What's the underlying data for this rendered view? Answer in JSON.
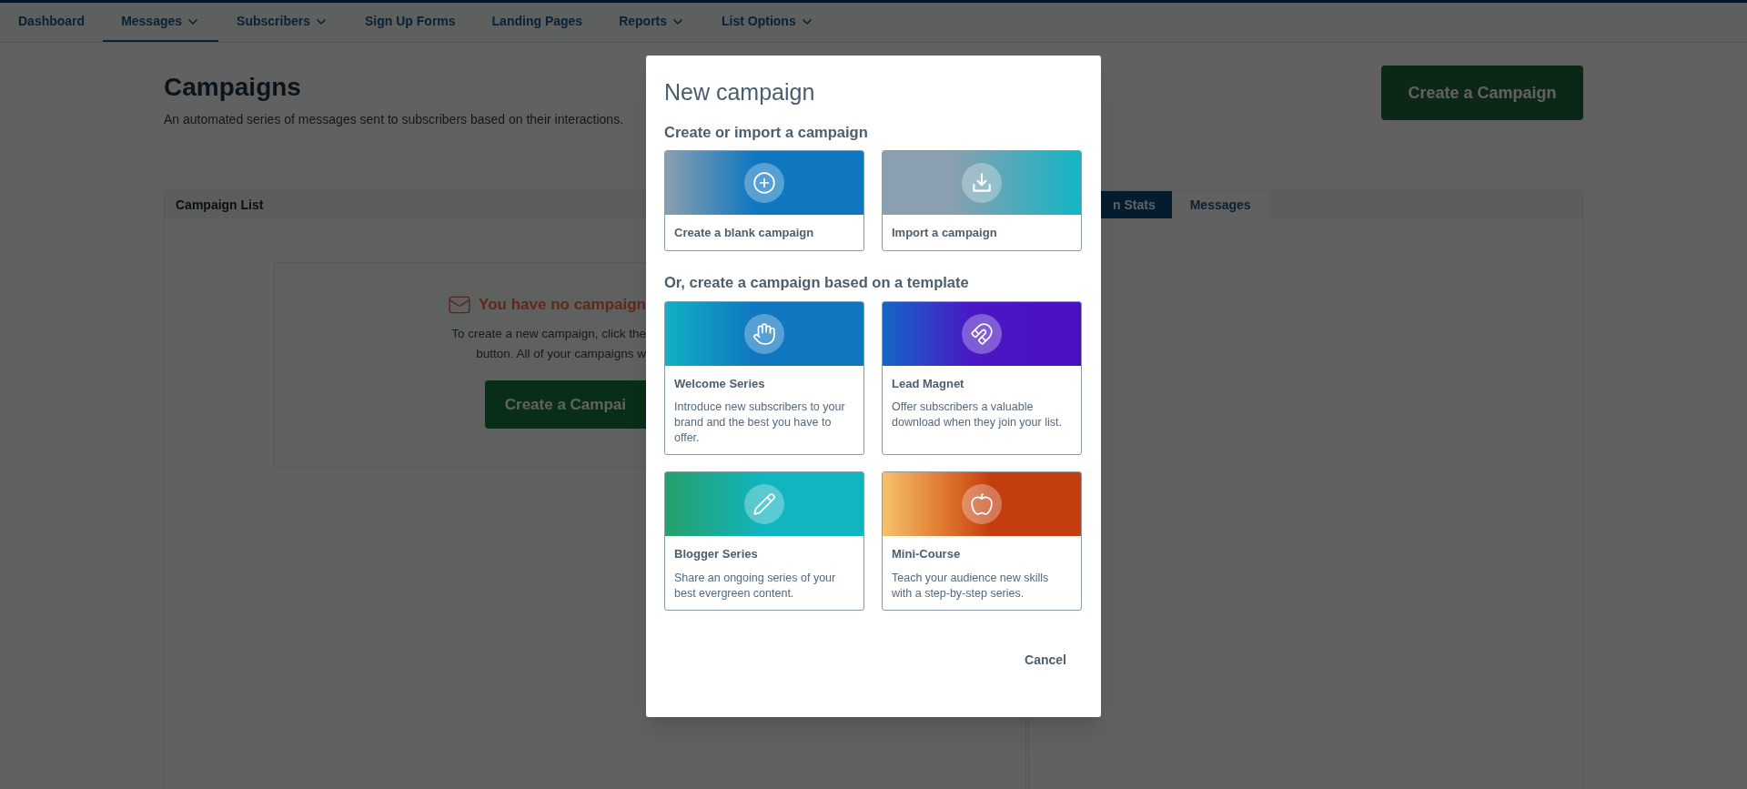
{
  "nav": {
    "items": [
      {
        "label": "Dashboard",
        "selected": false,
        "dropdown": false
      },
      {
        "label": "Messages",
        "selected": true,
        "dropdown": true
      },
      {
        "label": "Subscribers",
        "selected": false,
        "dropdown": true
      },
      {
        "label": "Sign Up Forms",
        "selected": false,
        "dropdown": false
      },
      {
        "label": "Landing Pages",
        "selected": false,
        "dropdown": false
      },
      {
        "label": "Reports",
        "selected": false,
        "dropdown": true
      },
      {
        "label": "List Options",
        "selected": false,
        "dropdown": true
      }
    ]
  },
  "page": {
    "title": "Campaigns",
    "subtitle": "An automated series of messages sent to subscribers based on their interactions.",
    "create_button": "Create a Campaign"
  },
  "campaign_list": {
    "title": "Campaign List",
    "empty_state": {
      "title": "You have no campaign",
      "text_lines": [
        "To create a new campaign, click the",
        "button. All of your campaigns w"
      ],
      "button": "Create a Campai"
    }
  },
  "stats_panel": {
    "tabs": [
      {
        "label": "n Stats",
        "selected": true
      },
      {
        "label": "Messages",
        "selected": false
      }
    ]
  },
  "modal": {
    "title": "New campaign",
    "sections": [
      {
        "heading": "Create or import a campaign",
        "cards": [
          {
            "kind": "blank",
            "title": "Create a blank campaign"
          },
          {
            "kind": "import",
            "title": "Import a campaign"
          }
        ]
      },
      {
        "heading": "Or, create a campaign based on a template",
        "cards": [
          {
            "kind": "welcome",
            "title": "Welcome Series",
            "description": "Introduce new subscribers to your brand and the best you have to offer."
          },
          {
            "kind": "magnet",
            "title": "Lead Magnet",
            "description": "Offer subscribers a valuable download when they join your list."
          },
          {
            "kind": "blogger",
            "title": "Blogger Series",
            "description": "Share an ongoing series of your best evergreen content."
          },
          {
            "kind": "course",
            "title": "Mini-Course",
            "description": "Teach your audience new skills with a step-by-step series."
          }
        ]
      }
    ],
    "cancel": "Cancel"
  }
}
